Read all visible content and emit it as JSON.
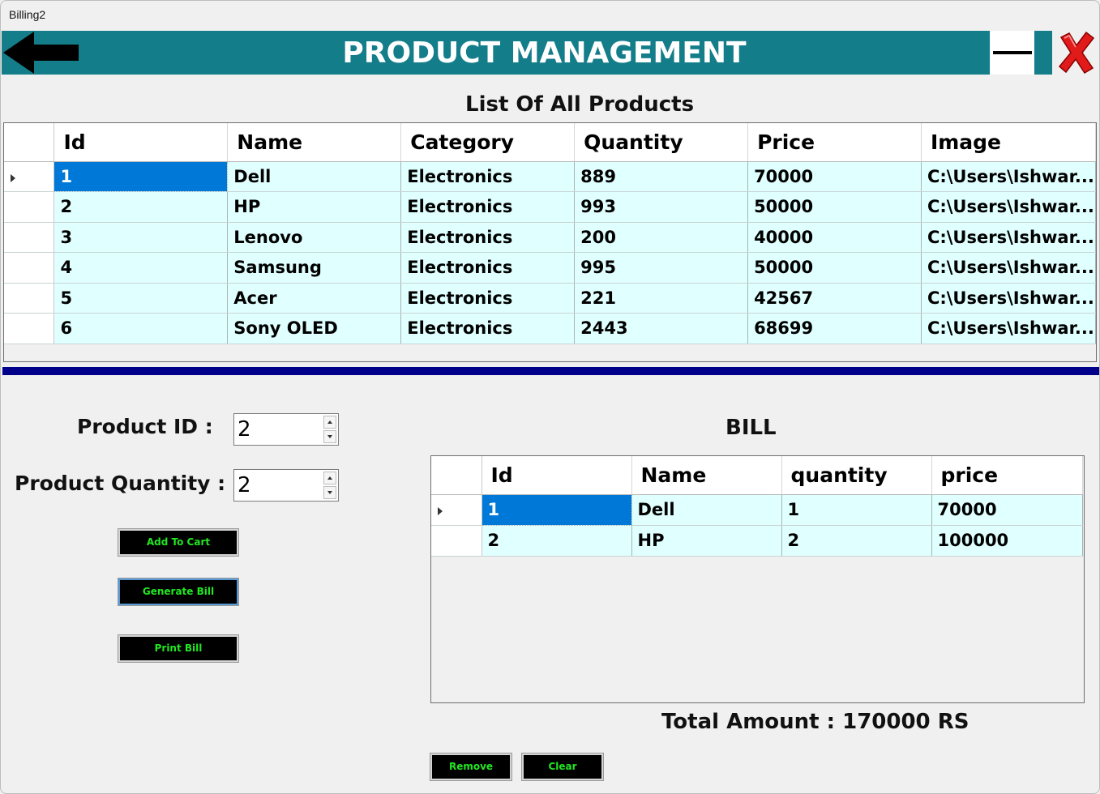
{
  "window": {
    "title": "Billing2"
  },
  "header": {
    "title": "PRODUCT MANAGEMENT",
    "back_icon": "back-arrow-icon",
    "minimize_icon": "minimize-icon",
    "close_icon": "close-x-icon"
  },
  "colors": {
    "header": "#147d8a",
    "divider": "#00008b",
    "row_bg": "#e0ffff",
    "selection": "#0078d7",
    "button_text": "#22e622"
  },
  "products": {
    "title": "List Of All Products",
    "columns": [
      "Id",
      "Name",
      "Category",
      "Quantity",
      "Price",
      "Image"
    ],
    "rows": [
      [
        "1",
        "Dell",
        "Electronics",
        "889",
        "70000",
        "C:\\Users\\Ishwar..."
      ],
      [
        "2",
        "HP",
        "Electronics",
        "993",
        "50000",
        "C:\\Users\\Ishwar..."
      ],
      [
        "3",
        "Lenovo",
        "Electronics",
        "200",
        "40000",
        "C:\\Users\\Ishwar..."
      ],
      [
        "4",
        "Samsung",
        "Electronics",
        "995",
        "50000",
        "C:\\Users\\Ishwar..."
      ],
      [
        "5",
        "Acer",
        "Electronics",
        "221",
        "42567",
        "C:\\Users\\Ishwar..."
      ],
      [
        "6",
        "Sony OLED",
        "Electronics",
        "2443",
        "68699",
        "C:\\Users\\Ishwar..."
      ]
    ]
  },
  "form": {
    "product_id_label": "Product ID :",
    "product_id_value": "2",
    "product_qty_label": "Product Quantity :",
    "product_qty_value": "2",
    "add_to_cart": "Add To Cart",
    "generate_bill": "Generate Bill",
    "print_bill": "Print Bill"
  },
  "bill": {
    "title": "BILL",
    "columns": [
      "Id",
      "Name",
      "quantity",
      "price"
    ],
    "rows": [
      [
        "1",
        "Dell",
        "1",
        "70000"
      ],
      [
        "2",
        "HP",
        "2",
        "100000"
      ]
    ],
    "total_text": "Total Amount : 170000 RS",
    "remove": "Remove",
    "clear": "Clear"
  }
}
